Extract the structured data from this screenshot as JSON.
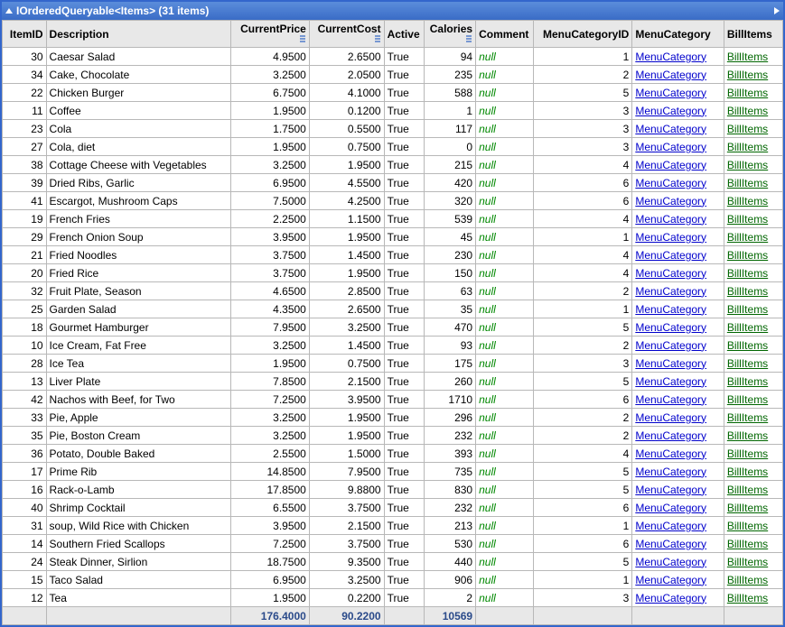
{
  "header": {
    "title": "IOrderedQueryable<Items> (31 items)"
  },
  "columns": {
    "itemid": "ItemID",
    "desc": "Description",
    "price": "CurrentPrice",
    "cost": "CurrentCost",
    "active": "Active",
    "cal": "Calories",
    "comment": "Comment",
    "catid": "MenuCategoryID",
    "cat": "MenuCategory",
    "bill": "BillItems"
  },
  "linkLabels": {
    "cat": "MenuCategory",
    "bill": "BillItems"
  },
  "nullLabel": "null",
  "rows": [
    {
      "id": 30,
      "desc": "Caesar Salad",
      "price": "4.9500",
      "cost": "2.6500",
      "active": "True",
      "cal": 94,
      "catid": 1
    },
    {
      "id": 34,
      "desc": "Cake, Chocolate",
      "price": "3.2500",
      "cost": "2.0500",
      "active": "True",
      "cal": 235,
      "catid": 2
    },
    {
      "id": 22,
      "desc": "Chicken Burger",
      "price": "6.7500",
      "cost": "4.1000",
      "active": "True",
      "cal": 588,
      "catid": 5
    },
    {
      "id": 11,
      "desc": "Coffee",
      "price": "1.9500",
      "cost": "0.1200",
      "active": "True",
      "cal": 1,
      "catid": 3
    },
    {
      "id": 23,
      "desc": "Cola",
      "price": "1.7500",
      "cost": "0.5500",
      "active": "True",
      "cal": 117,
      "catid": 3
    },
    {
      "id": 27,
      "desc": "Cola, diet",
      "price": "1.9500",
      "cost": "0.7500",
      "active": "True",
      "cal": 0,
      "catid": 3
    },
    {
      "id": 38,
      "desc": "Cottage Cheese with Vegetables",
      "price": "3.2500",
      "cost": "1.9500",
      "active": "True",
      "cal": 215,
      "catid": 4
    },
    {
      "id": 39,
      "desc": "Dried Ribs, Garlic",
      "price": "6.9500",
      "cost": "4.5500",
      "active": "True",
      "cal": 420,
      "catid": 6
    },
    {
      "id": 41,
      "desc": "Escargot, Mushroom Caps",
      "price": "7.5000",
      "cost": "4.2500",
      "active": "True",
      "cal": 320,
      "catid": 6
    },
    {
      "id": 19,
      "desc": "French Fries",
      "price": "2.2500",
      "cost": "1.1500",
      "active": "True",
      "cal": 539,
      "catid": 4
    },
    {
      "id": 29,
      "desc": "French Onion Soup",
      "price": "3.9500",
      "cost": "1.9500",
      "active": "True",
      "cal": 45,
      "catid": 1
    },
    {
      "id": 21,
      "desc": "Fried Noodles",
      "price": "3.7500",
      "cost": "1.4500",
      "active": "True",
      "cal": 230,
      "catid": 4
    },
    {
      "id": 20,
      "desc": "Fried Rice",
      "price": "3.7500",
      "cost": "1.9500",
      "active": "True",
      "cal": 150,
      "catid": 4
    },
    {
      "id": 32,
      "desc": "Fruit Plate, Season",
      "price": "4.6500",
      "cost": "2.8500",
      "active": "True",
      "cal": 63,
      "catid": 2
    },
    {
      "id": 25,
      "desc": "Garden Salad",
      "price": "4.3500",
      "cost": "2.6500",
      "active": "True",
      "cal": 35,
      "catid": 1
    },
    {
      "id": 18,
      "desc": "Gourmet Hamburger",
      "price": "7.9500",
      "cost": "3.2500",
      "active": "True",
      "cal": 470,
      "catid": 5
    },
    {
      "id": 10,
      "desc": "Ice Cream, Fat Free",
      "price": "3.2500",
      "cost": "1.4500",
      "active": "True",
      "cal": 93,
      "catid": 2
    },
    {
      "id": 28,
      "desc": "Ice Tea",
      "price": "1.9500",
      "cost": "0.7500",
      "active": "True",
      "cal": 175,
      "catid": 3
    },
    {
      "id": 13,
      "desc": "Liver Plate",
      "price": "7.8500",
      "cost": "2.1500",
      "active": "True",
      "cal": 260,
      "catid": 5
    },
    {
      "id": 42,
      "desc": "Nachos with Beef, for Two",
      "price": "7.2500",
      "cost": "3.9500",
      "active": "True",
      "cal": 1710,
      "catid": 6
    },
    {
      "id": 33,
      "desc": "Pie, Apple",
      "price": "3.2500",
      "cost": "1.9500",
      "active": "True",
      "cal": 296,
      "catid": 2
    },
    {
      "id": 35,
      "desc": "Pie, Boston Cream",
      "price": "3.2500",
      "cost": "1.9500",
      "active": "True",
      "cal": 232,
      "catid": 2
    },
    {
      "id": 36,
      "desc": "Potato, Double Baked",
      "price": "2.5500",
      "cost": "1.5000",
      "active": "True",
      "cal": 393,
      "catid": 4
    },
    {
      "id": 17,
      "desc": "Prime Rib",
      "price": "14.8500",
      "cost": "7.9500",
      "active": "True",
      "cal": 735,
      "catid": 5
    },
    {
      "id": 16,
      "desc": "Rack-o-Lamb",
      "price": "17.8500",
      "cost": "9.8800",
      "active": "True",
      "cal": 830,
      "catid": 5
    },
    {
      "id": 40,
      "desc": "Shrimp Cocktail",
      "price": "6.5500",
      "cost": "3.7500",
      "active": "True",
      "cal": 232,
      "catid": 6
    },
    {
      "id": 31,
      "desc": "soup, Wild Rice with Chicken",
      "price": "3.9500",
      "cost": "2.1500",
      "active": "True",
      "cal": 213,
      "catid": 1
    },
    {
      "id": 14,
      "desc": "Southern Fried Scallops",
      "price": "7.2500",
      "cost": "3.7500",
      "active": "True",
      "cal": 530,
      "catid": 6
    },
    {
      "id": 24,
      "desc": "Steak Dinner, Sirlion",
      "price": "18.7500",
      "cost": "9.3500",
      "active": "True",
      "cal": 440,
      "catid": 5
    },
    {
      "id": 15,
      "desc": "Taco Salad",
      "price": "6.9500",
      "cost": "3.2500",
      "active": "True",
      "cal": 906,
      "catid": 1
    },
    {
      "id": 12,
      "desc": "Tea",
      "price": "1.9500",
      "cost": "0.2200",
      "active": "True",
      "cal": 2,
      "catid": 3
    }
  ],
  "totals": {
    "price": "176.4000",
    "cost": "90.2200",
    "cal": "10569"
  }
}
